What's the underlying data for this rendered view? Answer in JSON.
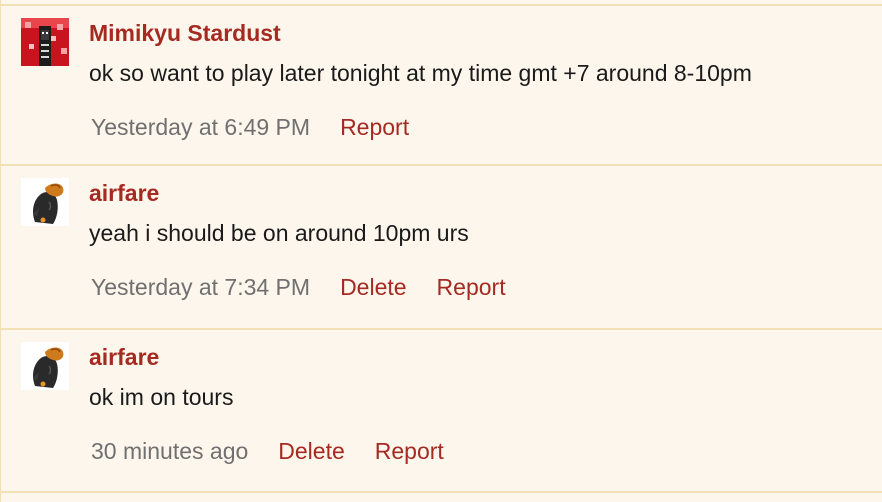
{
  "comments": [
    {
      "username": "Mimikyu Stardust",
      "text": "ok so want to play later tonight at my time gmt +7 around 8-10pm",
      "timestamp": "Yesterday at 6:49 PM",
      "actions": [
        "Report"
      ],
      "avatar_icon": "pixel-art-avatar"
    },
    {
      "username": "airfare",
      "text": "yeah i should be on around 10pm urs",
      "timestamp": "Yesterday at 7:34 PM",
      "actions": [
        "Delete",
        "Report"
      ],
      "avatar_icon": "chibi-character-avatar"
    },
    {
      "username": "airfare",
      "text": "ok im on tours",
      "timestamp": "30 minutes ago",
      "actions": [
        "Delete",
        "Report"
      ],
      "avatar_icon": "chibi-character-avatar"
    }
  ],
  "colors": {
    "background": "#fdf6ec",
    "border": "#f3e0b4",
    "link": "#a52a22",
    "timestamp": "#707070",
    "text": "#1a1a1a"
  }
}
